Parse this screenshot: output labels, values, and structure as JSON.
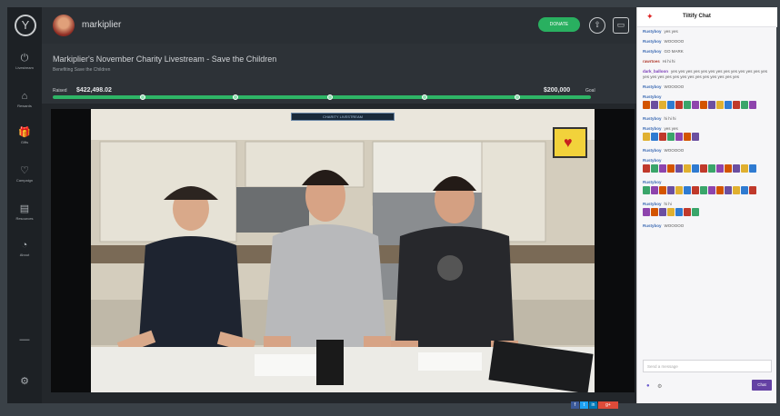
{
  "nav": {
    "logo_glyph": "Y",
    "items": [
      {
        "icon": "power-icon",
        "glyph": "⏻",
        "label": "Livestream"
      },
      {
        "icon": "home-icon",
        "glyph": "⌂",
        "label": "Rewards"
      },
      {
        "icon": "gift-icon",
        "glyph": "🎁",
        "label": "Gifts"
      },
      {
        "icon": "heart-icon",
        "glyph": "♡",
        "label": "Campaign"
      },
      {
        "icon": "folder-icon",
        "glyph": "▤",
        "label": "Resources"
      },
      {
        "icon": "info-icon",
        "glyph": "◔",
        "label": "About"
      }
    ],
    "collapse_glyph": "—",
    "settings_glyph": "⚙"
  },
  "topbar": {
    "username": "markiplier",
    "donate_label": "DONATE",
    "icons": [
      {
        "name": "upload-icon",
        "glyph": "⇧"
      },
      {
        "name": "window-icon",
        "glyph": "▭"
      }
    ]
  },
  "stream": {
    "title": "Markiplier's November Charity Livestream - Save the Children",
    "subtitle": "Benefiting Save the Children"
  },
  "progress": {
    "raised_label": "Raised",
    "raised_value": "$422,498.02",
    "goal_value": "$200,000",
    "goal_label": "Goal",
    "fill_fraction": 1.0
  },
  "video": {
    "overlay_text": "CHARITY LIVESTREAM"
  },
  "share": {
    "buttons": [
      "f",
      "t",
      "in",
      "g+"
    ]
  },
  "chat": {
    "logo_glyph": "✦",
    "title": "Tiltify Chat",
    "messages": [
      {
        "name": "Rustyboy",
        "name_class": "",
        "text": "yes yes",
        "emotes": 0
      },
      {
        "name": "Rustyboy",
        "name_class": "",
        "text": "WOOOOO",
        "emotes": 0
      },
      {
        "name": "Rustyboy",
        "name_class": "",
        "text": "GO MARK",
        "emotes": 0
      },
      {
        "name": "rawrtoes",
        "name_class": "r",
        "text": "Hi hi hi",
        "emotes": 0
      },
      {
        "name": "dark_balloon",
        "name_class": "v",
        "text": "yes yes yes yes yes yes yes yes yes yes yes yes yes yes yes yes yes yes yes yes yes yes yes yes yes yes",
        "emotes": 0
      },
      {
        "name": "Rustyboy",
        "name_class": "",
        "text": "WOOOOO",
        "emotes": 0
      },
      {
        "name": "Rustyboy",
        "name_class": "",
        "text": "",
        "emotes": 14
      },
      {
        "name": "Rustyboy",
        "name_class": "",
        "text": "hi hi hi",
        "emotes": 0
      },
      {
        "name": "Rustyboy",
        "name_class": "",
        "text": "yes yes",
        "emotes": 7
      },
      {
        "name": "Rustyboy",
        "name_class": "",
        "text": "WOOOOO",
        "emotes": 0
      },
      {
        "name": "Rustyboy",
        "name_class": "",
        "text": "",
        "emotes": 14
      },
      {
        "name": "Rustyboy",
        "name_class": "",
        "text": "",
        "emotes": 14
      },
      {
        "name": "Rustyboy",
        "name_class": "",
        "text": "hi hi",
        "emotes": 7
      },
      {
        "name": "Rustyboy",
        "name_class": "",
        "text": "WOOOOO",
        "emotes": 0
      }
    ],
    "input_placeholder": "Send a message",
    "footer_glyphs": [
      "●",
      "⚙"
    ],
    "send_label": "Chat"
  },
  "colors": {
    "accent_green": "#2eb566",
    "chat_purple": "#6441a4"
  }
}
